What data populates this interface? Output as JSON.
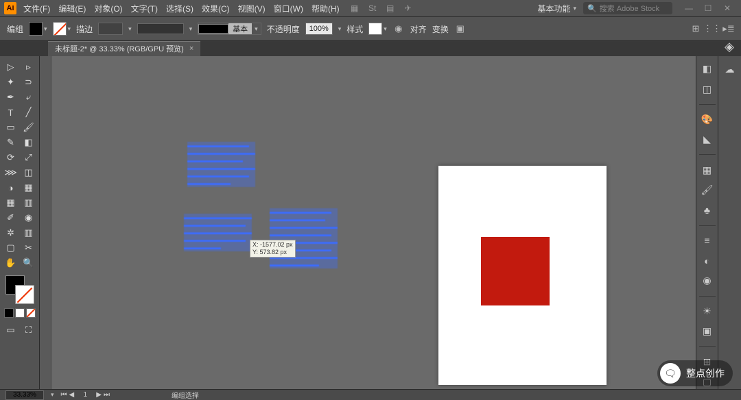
{
  "app": {
    "logo_text": "Ai"
  },
  "menus": [
    "文件(F)",
    "编辑(E)",
    "对象(O)",
    "文字(T)",
    "选择(S)",
    "效果(C)",
    "视图(V)",
    "窗口(W)",
    "帮助(H)"
  ],
  "titlebar": {
    "workspace": "基本功能",
    "search_placeholder": "搜索 Adobe Stock"
  },
  "control": {
    "label": "编组",
    "stroke_label": "描边",
    "stroke_weight": "",
    "basic_label": "基本",
    "opacity_label": "不透明度",
    "opacity_value": "100%",
    "style_label": "样式",
    "align_label": "对齐",
    "transform_label": "变换"
  },
  "document": {
    "tab_title": "未标题-2* @ 33.33% (RGB/GPU 预览)"
  },
  "canvas": {
    "coord_tip_x": "X: -1577.02 px",
    "coord_tip_y": "Y: 573.82 px",
    "placeholder_lines_1": [
      "▬▬▬▬▬▬▬▬▬▬",
      "▬▬▬▬▬▬▬▬▬▬▬",
      "▬▬▬▬▬▬▬▬▬",
      "▬▬▬▬▬▬▬▬▬▬▬",
      "▬▬▬▬▬▬▬▬▬▬",
      "▬▬▬▬▬▬▬"
    ],
    "placeholder_lines_2": [
      "▬▬▬▬▬▬▬▬▬▬▬",
      "▬▬▬▬▬▬▬▬▬▬",
      "▬▬▬▬▬▬▬▬▬▬▬",
      "▬▬▬▬▬▬▬▬▬▬",
      "▬▬▬▬▬▬"
    ],
    "placeholder_lines_3": [
      "▬▬▬▬▬▬▬▬▬▬",
      "▬▬▬▬▬▬▬▬▬",
      "▬▬▬▬▬▬▬▬▬▬▬",
      "▬▬▬▬▬▬▬▬▬▬",
      "▬▬▬▬▬▬▬▬▬▬▬",
      "▬▬▬▬▬▬▬▬▬▬",
      "▬▬▬▬▬▬▬▬▬▬▬",
      "▬▬▬▬▬▬▬▬"
    ]
  },
  "status": {
    "zoom": "33.33%",
    "tool_hint": "编组选择"
  },
  "watermark": {
    "icon": "🗨",
    "text": "整点创作"
  }
}
